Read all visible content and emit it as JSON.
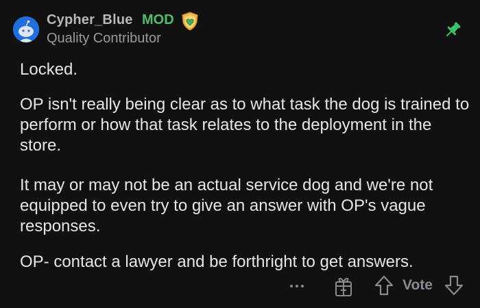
{
  "comment": {
    "author": "Cypher_Blue",
    "role_badge": "MOD",
    "flair": "Quality Contributor",
    "paragraphs": [
      "Locked.",
      "OP isn't really being clear as to what task the dog is trained to perform or how that task relates to the deployment in the store.",
      "It may or may not be an actual service dog and we're not equipped to even try to give an answer with OP's vague responses.",
      "OP- contact a lawyer and be forthright to get answers."
    ]
  },
  "actions": {
    "more_icon": "ellipsis-icon",
    "award_icon": "gift-icon",
    "upvote_icon": "arrow-up-icon",
    "vote_label": "Vote",
    "downvote_icon": "arrow-down-icon"
  },
  "colors": {
    "background": "#111112",
    "mod_green": "#4fbf6a",
    "pin_green": "#3ec16b",
    "avatar_blue": "#1f6fe0"
  },
  "icons": {
    "avatar": "avatar-snoo",
    "mod_badge": "heart-shield-icon",
    "pin": "pin-icon"
  }
}
